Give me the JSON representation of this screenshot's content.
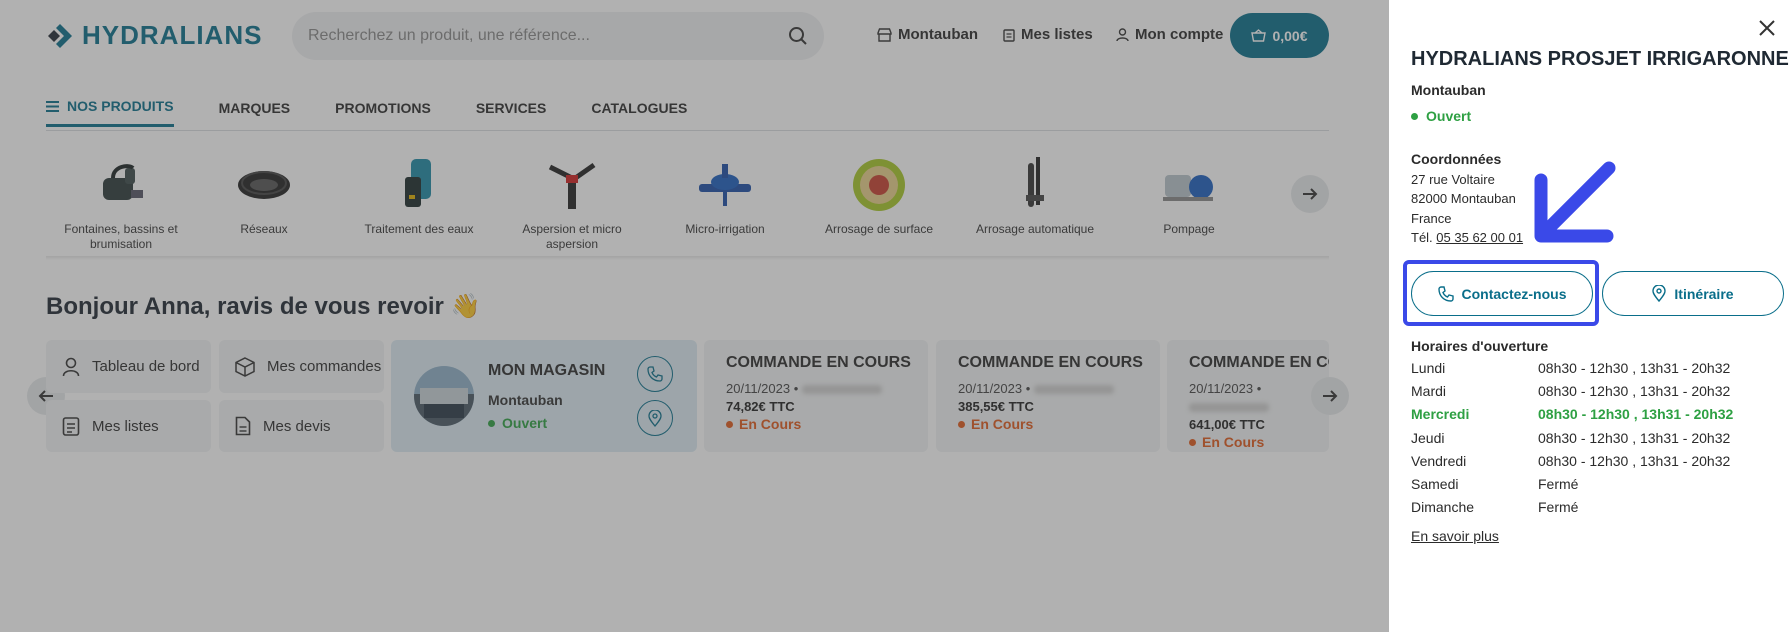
{
  "header": {
    "logo_text": "HYDRALIANS",
    "search_placeholder": "Recherchez un produit, une référence...",
    "store_link": "Montauban",
    "lists_link": "Mes listes",
    "account_link": "Mon compte",
    "cart_total": "0,00€",
    "brand_color": "#0a6e8a"
  },
  "menu": {
    "items": [
      {
        "label": "NOS PRODUITS",
        "active": true
      },
      {
        "label": "MARQUES"
      },
      {
        "label": "PROMOTIONS"
      },
      {
        "label": "SERVICES"
      },
      {
        "label": "CATALOGUES"
      }
    ]
  },
  "categories": [
    {
      "label": "Fontaines, bassins et brumisation",
      "icon": "pond-pump-icon"
    },
    {
      "label": "Réseaux",
      "icon": "hose-coil-icon"
    },
    {
      "label": "Traitement des eaux",
      "icon": "water-filter-icon"
    },
    {
      "label": "Aspersion et micro aspersion",
      "icon": "sprinkler-icon"
    },
    {
      "label": "Micro-irrigation",
      "icon": "dripper-icon"
    },
    {
      "label": "Arrosage de surface",
      "icon": "garden-hose-icon"
    },
    {
      "label": "Arrosage automatique",
      "icon": "irrigation-controller-icon"
    },
    {
      "label": "Pompage",
      "icon": "water-pump-icon"
    }
  ],
  "greeting": "Bonjour Anna, ravis de vous revoir 👋",
  "dashboard": {
    "tiles": [
      {
        "label": "Tableau de bord",
        "icon": "user-icon"
      },
      {
        "label": "Mes commandes",
        "icon": "box-icon"
      },
      {
        "label": "Mes listes",
        "icon": "checklist-icon"
      },
      {
        "label": "Mes devis",
        "icon": "document-icon"
      }
    ],
    "store": {
      "title": "MON MAGASIN",
      "city": "Montauban",
      "status": "Ouvert"
    },
    "orders": [
      {
        "title": "COMMANDE EN COURS",
        "date": "20/11/2023 •",
        "price": "74,82€ TTC",
        "status": "En Cours"
      },
      {
        "title": "COMMANDE EN COURS",
        "date": "20/11/2023 •",
        "price": "385,55€ TTC",
        "status": "En Cours"
      },
      {
        "title": "COMMANDE EN CO",
        "date": "20/11/2023 •",
        "price": "641,00€ TTC",
        "status": "En Cours"
      }
    ]
  },
  "panel": {
    "title": "HYDRALIANS PROSJET IRRIGARONNE",
    "city": "Montauban",
    "status": "Ouvert",
    "coord_heading": "Coordonnées",
    "address_line1": "27 rue Voltaire",
    "address_line2": "82000 Montauban",
    "address_line3": "France",
    "phone_prefix": "Tél.",
    "phone": "05 35 62 00 01",
    "contact_button": "Contactez-nous",
    "route_button": "Itinéraire",
    "hours_heading": "Horaires d'ouverture",
    "hours": [
      {
        "day": "Lundi",
        "time": "08h30 - 12h30 , 13h31 - 20h32"
      },
      {
        "day": "Mardi",
        "time": "08h30 - 12h30 , 13h31 - 20h32"
      },
      {
        "day": "Mercredi",
        "time": "08h30 - 12h30 , 13h31 - 20h32",
        "today": true
      },
      {
        "day": "Jeudi",
        "time": "08h30 - 12h30 , 13h31 - 20h32"
      },
      {
        "day": "Vendredi",
        "time": "08h30 - 12h30 , 13h31 - 20h32"
      },
      {
        "day": "Samedi",
        "time": "Fermé"
      },
      {
        "day": "Dimanche",
        "time": "Fermé"
      }
    ],
    "more_link": "En savoir plus",
    "status_color": "#2ea043",
    "annotation_color": "#3a49e8"
  }
}
